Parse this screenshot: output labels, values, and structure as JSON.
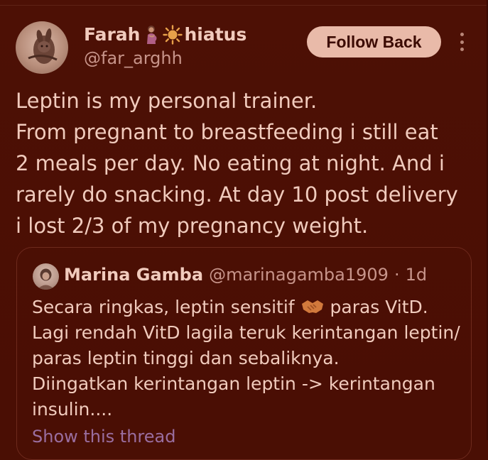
{
  "author": {
    "display_name_prefix": "Farah",
    "display_name_suffix": "hiatus",
    "name_emojis": [
      "pregnant-woman-emoji",
      "sun-emoji"
    ],
    "handle": "@far_arghh"
  },
  "actions": {
    "follow_back_label": "Follow Back",
    "more_icon": "more-vertical-icon"
  },
  "tweet": {
    "lines": [
      "Leptin is my personal trainer.",
      "From pregnant to breastfeeding i still eat",
      "2 meals per day. No eating at night. And i",
      "rarely do snacking. At day 10 post delivery",
      "i lost 2/3 of my pregnancy weight."
    ]
  },
  "quoted": {
    "name": "Marina Gamba",
    "handle": "@marinagamba1909",
    "separator": "·",
    "time": "1d",
    "line1_before": "Secara ringkas, leptin sensitif",
    "line1_emoji": "handshake-emoji",
    "line1_after": "paras VitD.",
    "lines": [
      "Lagi rendah VitD lagila teruk kerintangan leptin/",
      "paras leptin tinggi dan sebaliknya.",
      "Diingatkan kerintangan leptin -> kerintangan",
      "insulin...."
    ],
    "show_thread": "Show this thread"
  },
  "colors": {
    "background": "#4a0f04",
    "text": "#f1cbbd",
    "muted": "#c7948a",
    "button": "#e9baa9",
    "link": "#9a6ea0"
  }
}
